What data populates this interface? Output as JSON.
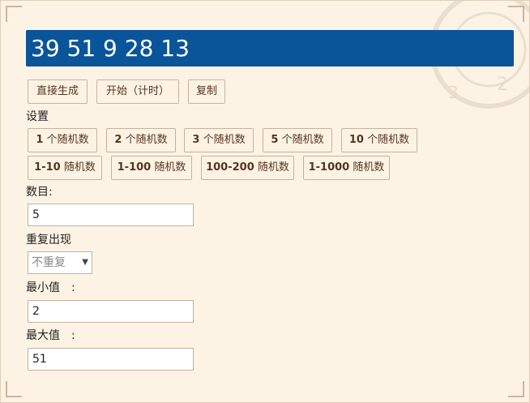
{
  "result": "39 51 9 28 13",
  "actions": {
    "generate": "直接生成",
    "start": "开始（计时）",
    "copy": "复制"
  },
  "settings_label": "设置",
  "count_options": [
    {
      "num": "1",
      "suffix": " 个随机数"
    },
    {
      "num": "2",
      "suffix": " 个随机数"
    },
    {
      "num": "3",
      "suffix": " 个随机数"
    },
    {
      "num": "5",
      "suffix": " 个随机数"
    },
    {
      "num": "10",
      "suffix": " 个随机数"
    }
  ],
  "range_options": [
    {
      "num": "1-10",
      "suffix": " 随机数"
    },
    {
      "num": "1-100",
      "suffix": " 随机数"
    },
    {
      "num": "100-200",
      "suffix": " 随机数"
    },
    {
      "num": "1-1000",
      "suffix": " 随机数"
    }
  ],
  "count": {
    "label": "数目:",
    "value": "5"
  },
  "repeat": {
    "label": "重复出现",
    "selected": "不重复"
  },
  "min": {
    "label": "最小值　:",
    "value": "2"
  },
  "max": {
    "label": "最大值　:",
    "value": "51"
  }
}
